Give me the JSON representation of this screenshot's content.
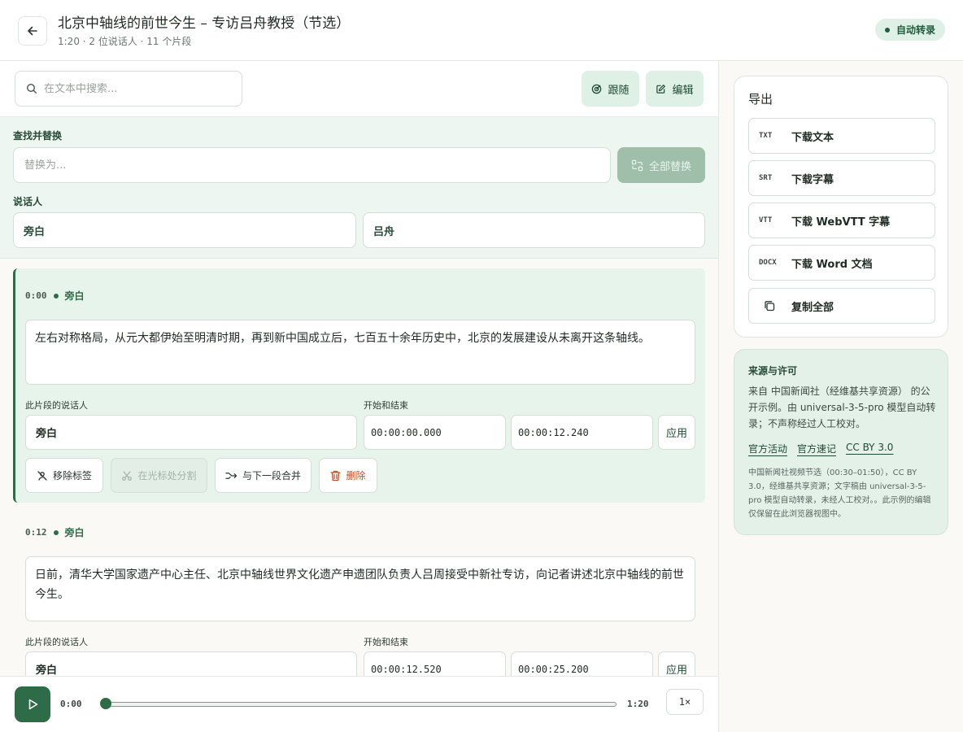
{
  "header": {
    "title": "北京中轴线的前世今生 – 专访吕舟教授（节选）",
    "meta": "1:20 · 2 位说话人 · 11 个片段",
    "badge": "自动转录"
  },
  "toolbar": {
    "search_placeholder": "在文本中搜索...",
    "follow_label": "跟随",
    "edit_label": "编辑"
  },
  "replace": {
    "section_label": "查找并替换",
    "input_placeholder": "替换为...",
    "replace_all_label": "全部替换",
    "speakers_label": "说话人",
    "speakers": [
      "旁白",
      "吕舟"
    ]
  },
  "segments": [
    {
      "time": "0:00",
      "speaker": "旁白",
      "text": "左右对称格局，从元大都伊始至明清时期，再到新中国成立后，七百五十余年历史中，北京的发展建设从未离开这条轴线。",
      "speaker_field_label": "此片段的说话人",
      "range_label": "开始和结束",
      "speaker_value": "旁白",
      "start": "00:00:00.000",
      "end": "00:00:12.240",
      "apply_label": "应用",
      "actions": {
        "remove_label": "移除标签",
        "split_label": "在光标处分割",
        "merge_label": "与下一段合并",
        "delete_label": "删除"
      }
    },
    {
      "time": "0:12",
      "speaker": "旁白",
      "text": "日前，清华大学国家遗产中心主任、北京中轴线世界文化遗产申遗团队负责人吕周接受中新社专访，向记者讲述北京中轴线的前世今生。",
      "speaker_field_label": "此片段的说话人",
      "range_label": "开始和结束",
      "speaker_value": "旁白",
      "start": "00:00:12.520",
      "end": "00:00:25.200",
      "apply_label": "应用"
    }
  ],
  "player": {
    "current": "0:00",
    "duration": "1:20",
    "speed": "1×",
    "progress": 0
  },
  "export": {
    "title": "导出",
    "items": [
      {
        "format": "TXT",
        "label": "下载文本"
      },
      {
        "format": "SRT",
        "label": "下载字幕"
      },
      {
        "format": "VTT",
        "label": "下载 WebVTT 字幕"
      },
      {
        "format": "DOCX",
        "label": "下载 Word 文档"
      }
    ],
    "copy_label": "复制全部"
  },
  "source": {
    "title": "来源与许可",
    "description": "来自 中国新闻社（经维基共享资源） 的公开示例。由 universal-3-5-pro 模型自动转录；不声称经过人工校对。",
    "links": [
      "官方活动",
      "官方速记",
      "CC BY 3.0"
    ],
    "note": "中国新闻社视频节选（00:30–01:50），CC BY 3.0，经维基共享资源；文字稿由 universal-3-5-pro 模型自动转录，未经人工校对。。此示例的编辑仅保留在此浏览器视图中。"
  },
  "colors": {
    "accent": "#2e6b47",
    "accent_light": "#dff0e6",
    "panel_bg": "#edf6f0",
    "danger": "#c0502a"
  }
}
